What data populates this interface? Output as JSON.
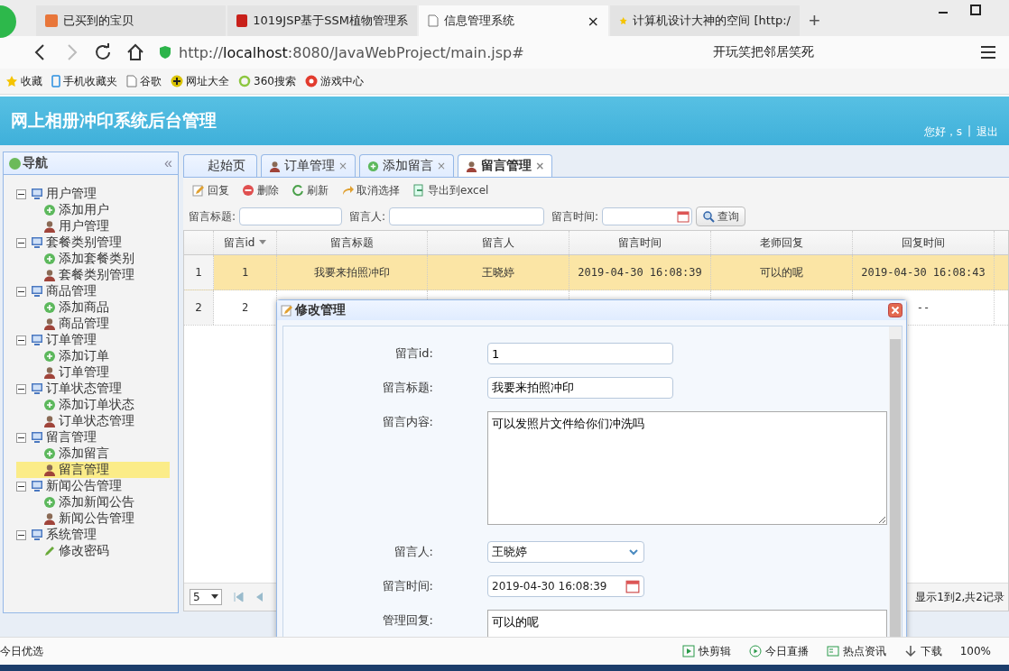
{
  "browser": {
    "tabs": [
      {
        "title": "已买到的宝贝",
        "kind": "shop",
        "selected": false
      },
      {
        "title": "1019JSP基于SSM植物管理系",
        "kind": "red",
        "selected": false
      },
      {
        "title": "信息管理系统",
        "kind": "page",
        "selected": true,
        "close": "×"
      },
      {
        "title": "计算机设计大神的空间 [http:/",
        "kind": "star",
        "selected": false
      }
    ],
    "new_tab": "+",
    "address": "http://**localhost**:8080/JavaWebProject/main.jsp#",
    "search": "开玩笑把邻居笑死",
    "bookmarks": [
      {
        "label": "收藏",
        "kind": "star"
      },
      {
        "label": "手机收藏夹",
        "kind": "phone"
      },
      {
        "label": "谷歌",
        "kind": "page"
      },
      {
        "label": "网址大全",
        "kind": "plus"
      },
      {
        "label": "360搜索",
        "kind": "ring"
      },
      {
        "label": "游戏中心",
        "kind": "game"
      }
    ]
  },
  "app": {
    "title": "网上相册冲印系统后台管理",
    "greeting": "您好，s",
    "separator": "|",
    "logout": "退出"
  },
  "nav": {
    "title": "导航",
    "collapse": "«",
    "items": [
      {
        "label": "用户管理",
        "expanded": true,
        "children": [
          {
            "label": "添加用户",
            "kind": "add",
            "selected": false
          },
          {
            "label": "用户管理",
            "kind": "manage",
            "selected": false
          }
        ]
      },
      {
        "label": "套餐类别管理",
        "expanded": true,
        "children": [
          {
            "label": "添加套餐类别",
            "kind": "add",
            "selected": false
          },
          {
            "label": "套餐类别管理",
            "kind": "manage",
            "selected": false
          }
        ]
      },
      {
        "label": "商品管理",
        "expanded": true,
        "children": [
          {
            "label": "添加商品",
            "kind": "add",
            "selected": false
          },
          {
            "label": "商品管理",
            "kind": "manage",
            "selected": false
          }
        ]
      },
      {
        "label": "订单管理",
        "expanded": true,
        "children": [
          {
            "label": "添加订单",
            "kind": "add",
            "selected": false
          },
          {
            "label": "订单管理",
            "kind": "manage",
            "selected": false
          }
        ]
      },
      {
        "label": "订单状态管理",
        "expanded": true,
        "children": [
          {
            "label": "添加订单状态",
            "kind": "add",
            "selected": false
          },
          {
            "label": "订单状态管理",
            "kind": "manage",
            "selected": false
          }
        ]
      },
      {
        "label": "留言管理",
        "expanded": true,
        "children": [
          {
            "label": "添加留言",
            "kind": "add",
            "selected": false
          },
          {
            "label": "留言管理",
            "kind": "manage",
            "selected": true
          }
        ]
      },
      {
        "label": "新闻公告管理",
        "expanded": true,
        "children": [
          {
            "label": "添加新闻公告",
            "kind": "add",
            "selected": false
          },
          {
            "label": "新闻公告管理",
            "kind": "manage",
            "selected": false
          }
        ]
      },
      {
        "label": "系统管理",
        "expanded": true,
        "children": [
          {
            "label": "修改密码",
            "kind": "edit",
            "selected": false
          }
        ]
      }
    ]
  },
  "tabs": [
    {
      "label": "起始页",
      "kind": "home",
      "selected": false,
      "close": false
    },
    {
      "label": "订单管理",
      "kind": "manage",
      "selected": false,
      "close": true
    },
    {
      "label": "添加留言",
      "kind": "add",
      "selected": false,
      "close": true
    },
    {
      "label": "留言管理",
      "kind": "manage",
      "selected": true,
      "close": true
    }
  ],
  "tab_close": "×",
  "toolbar": [
    {
      "label": "回复",
      "kind": "edit"
    },
    {
      "label": "删除",
      "kind": "remove"
    },
    {
      "label": "刷新",
      "kind": "reload"
    },
    {
      "label": "取消选择",
      "kind": "undo"
    },
    {
      "label": "导出到excel",
      "kind": "export"
    }
  ],
  "search": {
    "title_label": "留言标题:",
    "person_label": "留言人:",
    "time_label": "留言时间:",
    "button": "查询"
  },
  "table": {
    "columns": [
      "留言id",
      "留言标题",
      "留言人",
      "留言时间",
      "老师回复",
      "回复时间"
    ],
    "rows": [
      {
        "num": "1",
        "selected": true,
        "cells": [
          "1",
          "我要来拍照冲印",
          "王晓婷",
          "2019-04-30 16:08:39",
          "可以的呢",
          "2019-04-30 16:08:43"
        ]
      },
      {
        "num": "2",
        "selected": false,
        "cells": [
          "2",
          null,
          null,
          null,
          null,
          "--"
        ]
      }
    ]
  },
  "pager": {
    "page_size": "5",
    "info": "显示1到2,共2记录"
  },
  "dialog": {
    "title": "修改管理",
    "fields": [
      {
        "label": "留言id:",
        "kind": "text",
        "value": "1"
      },
      {
        "label": "留言标题:",
        "kind": "text",
        "value": "我要来拍照冲印"
      },
      {
        "label": "留言内容:",
        "kind": "textarea",
        "value": "可以发照片文件给你们冲洗吗"
      },
      {
        "label": "留言人:",
        "kind": "select",
        "value": "王晓婷"
      },
      {
        "label": "留言时间:",
        "kind": "date",
        "value": "2019-04-30 16:08:39"
      },
      {
        "label": "管理回复:",
        "kind": "reply",
        "value": "可以的呢"
      }
    ]
  },
  "status_bar": {
    "left": "今日优选",
    "items": [
      {
        "label": "快剪辑",
        "kind": "play"
      },
      {
        "label": "今日直播",
        "kind": "live"
      },
      {
        "label": "热点资讯",
        "kind": "news"
      },
      {
        "label": "下载",
        "kind": "down"
      }
    ],
    "zoom": "100%"
  }
}
